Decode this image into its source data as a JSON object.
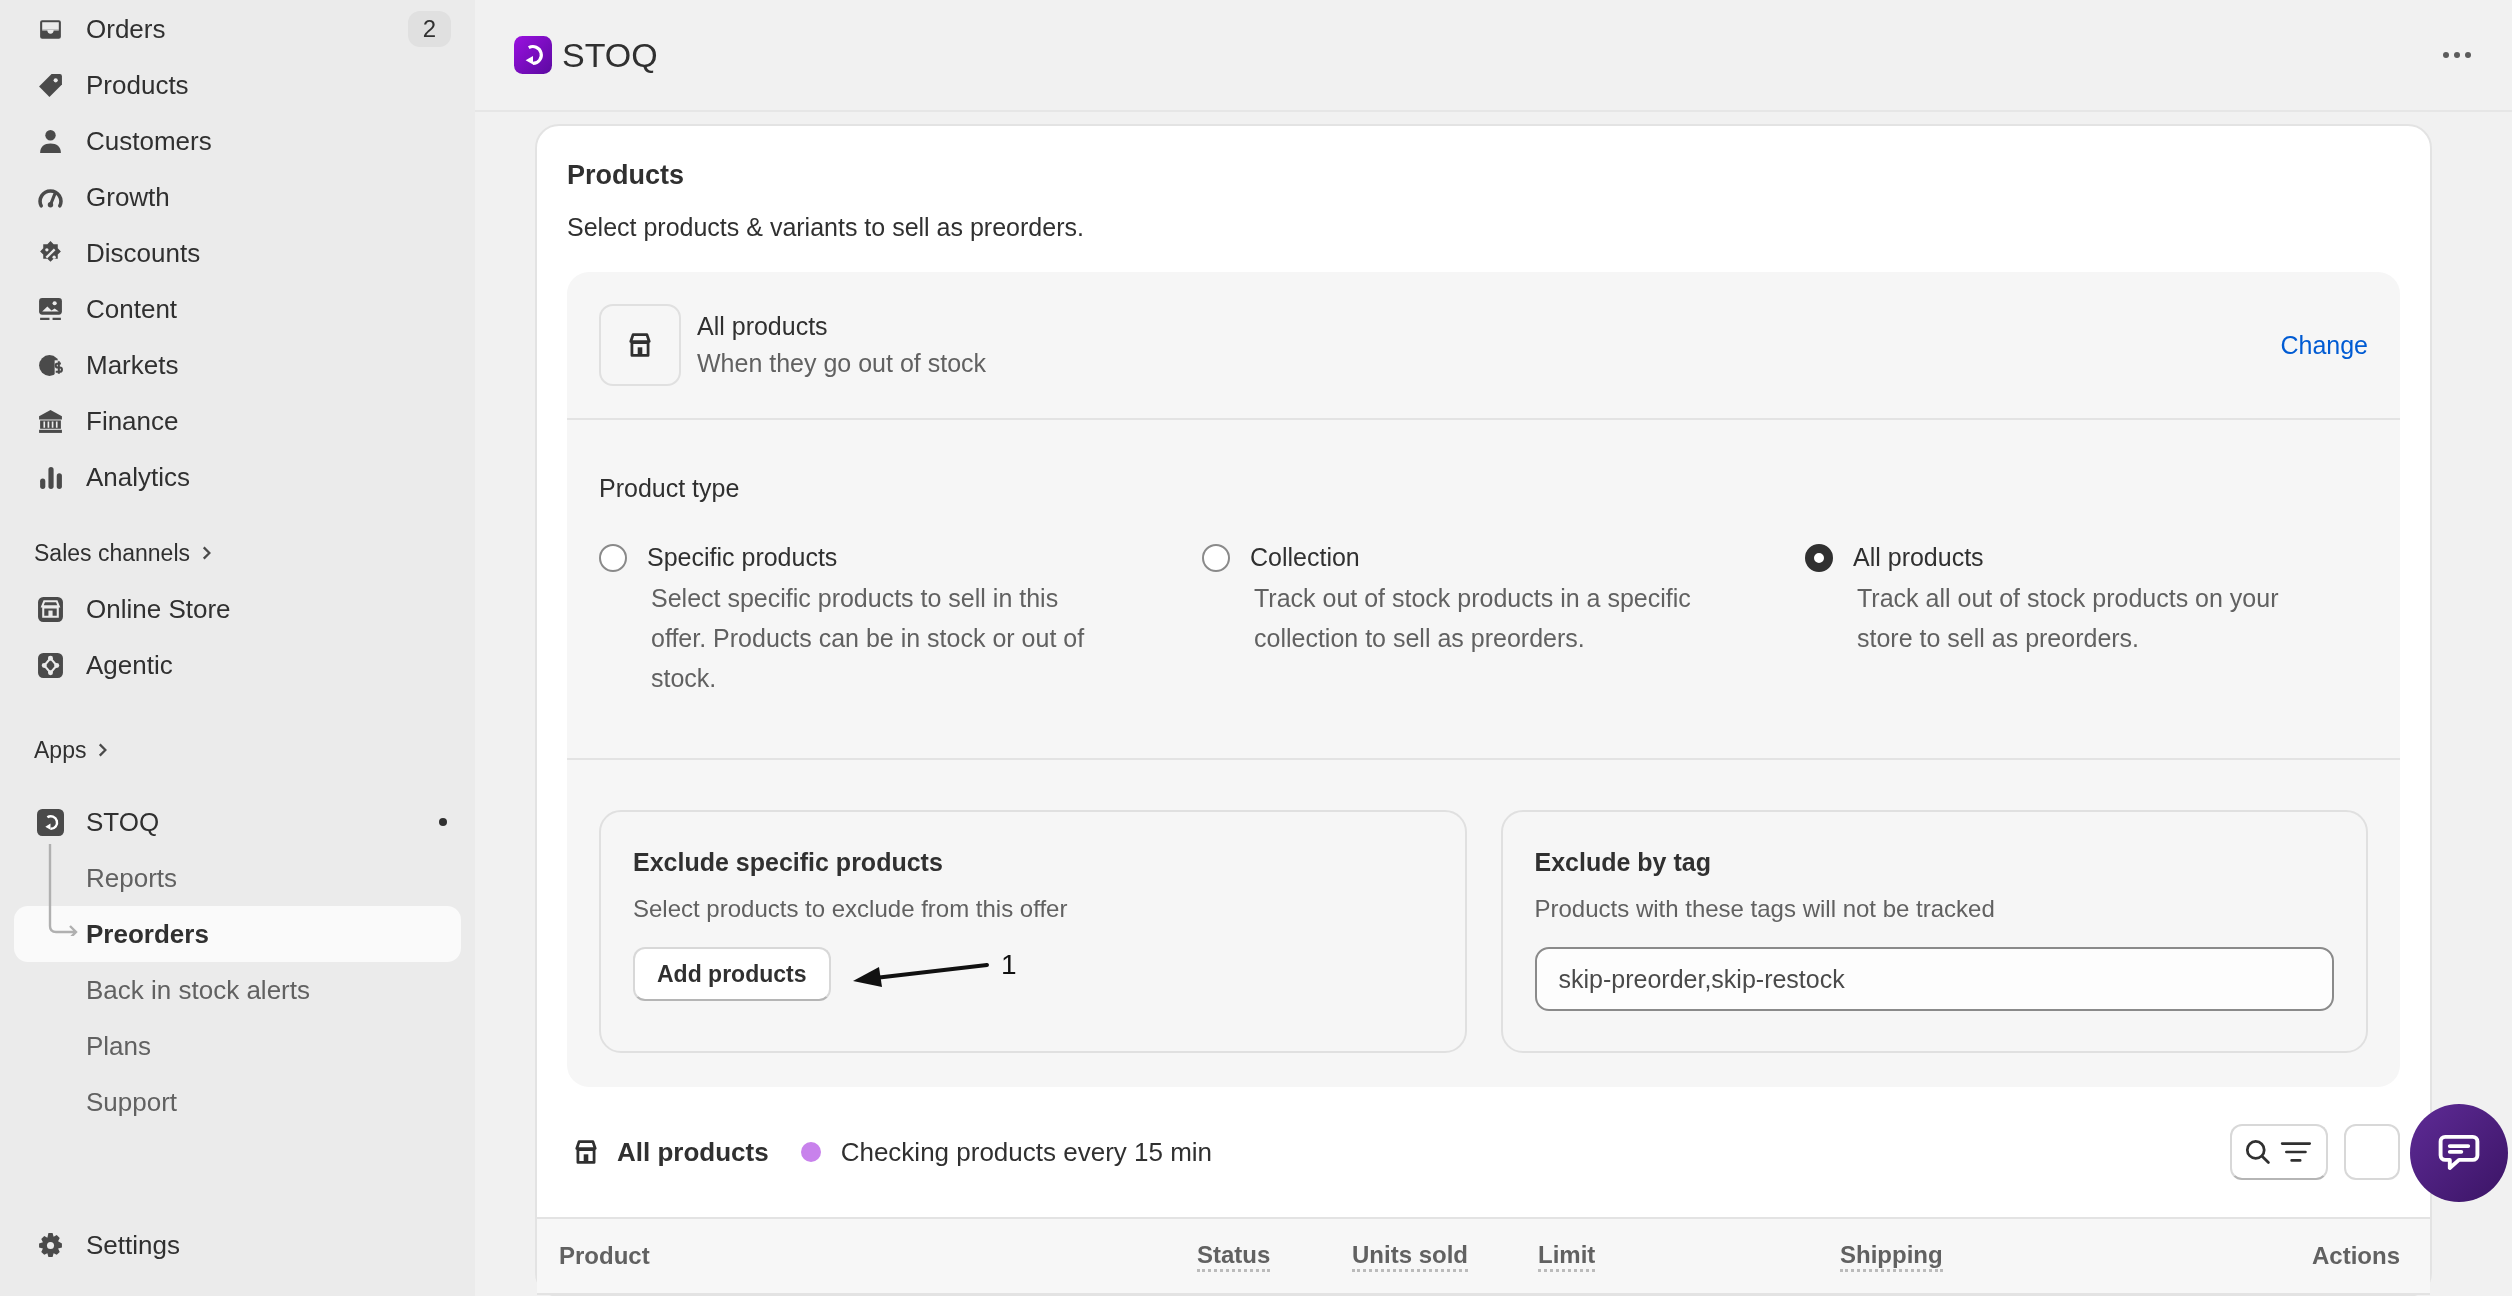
{
  "sidebar": {
    "nav": [
      {
        "label": "Orders",
        "badge": "2"
      },
      {
        "label": "Products"
      },
      {
        "label": "Customers"
      },
      {
        "label": "Growth"
      },
      {
        "label": "Discounts"
      },
      {
        "label": "Content"
      },
      {
        "label": "Markets"
      },
      {
        "label": "Finance"
      },
      {
        "label": "Analytics"
      }
    ],
    "sales_channels": {
      "label": "Sales channels",
      "items": [
        "Online Store",
        "Agentic"
      ]
    },
    "apps": {
      "label": "Apps",
      "items": [
        {
          "label": "STOQ",
          "children": [
            {
              "label": "Reports",
              "selected": false
            },
            {
              "label": "Preorders",
              "selected": true
            },
            {
              "label": "Back in stock alerts",
              "selected": false
            },
            {
              "label": "Plans",
              "selected": false
            },
            {
              "label": "Support",
              "selected": false
            }
          ]
        }
      ]
    },
    "settings": "Settings"
  },
  "header": {
    "app_name": "STOQ"
  },
  "products_card": {
    "title": "Products",
    "subtitle": "Select products & variants to sell as preorders.",
    "scope": {
      "title": "All products",
      "subtitle": "When they go out of stock",
      "action": "Change"
    },
    "product_type": {
      "label": "Product type",
      "options": [
        {
          "label": "Specific products",
          "description": "Select specific products to sell in this offer. Products can be in stock or out of stock.",
          "selected": false
        },
        {
          "label": "Collection",
          "description": "Track out of stock products in a specific collection to sell as preorders.",
          "selected": false
        },
        {
          "label": "All products",
          "description": "Track all out of stock products on your store to sell as preorders.",
          "selected": true
        }
      ]
    },
    "exclusions": [
      {
        "kind": "button",
        "title": "Exclude specific products",
        "description": "Select products to exclude from this offer",
        "button": "Add products"
      },
      {
        "kind": "field",
        "title": "Exclude by tag",
        "description": "Products with these tags will not be tracked",
        "value": "skip-preorder,skip-restock"
      }
    ],
    "annotation": {
      "label": "1"
    }
  },
  "table": {
    "scope": "All products",
    "status": "Checking products every 15 min",
    "columns": [
      {
        "label": "Product",
        "has_tooltip": false
      },
      {
        "label": "Status",
        "has_tooltip": true
      },
      {
        "label": "Units sold",
        "has_tooltip": true
      },
      {
        "label": "Limit",
        "has_tooltip": true
      },
      {
        "label": "Shipping",
        "has_tooltip": true
      },
      {
        "label": "Actions",
        "has_tooltip": false
      }
    ]
  }
}
